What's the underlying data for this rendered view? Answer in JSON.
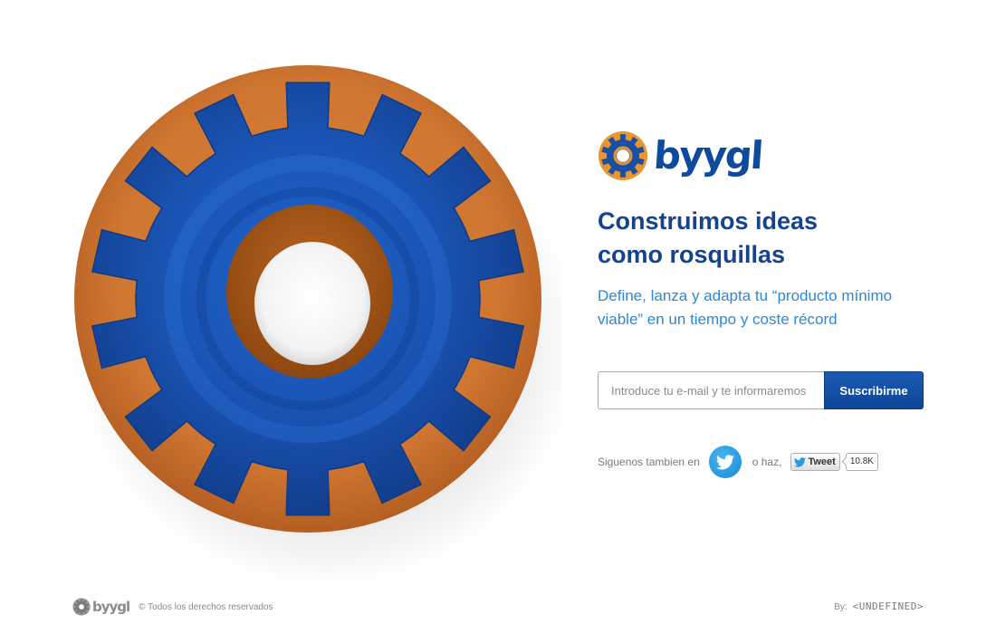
{
  "brand": {
    "name": "byygl",
    "logo_icon": "gear-donut-icon"
  },
  "hero": {
    "illustration": "gear-donut-illustration",
    "headline_line1": "Construimos ideas",
    "headline_line2": "como rosquillas",
    "subheadline": "Define, lanza y adapta tu “producto mínimo viable” en un tiempo y coste récord"
  },
  "signup": {
    "email_placeholder": "Introduce tu e-mail y te informaremos",
    "email_value": "",
    "submit_label": "Suscribirme"
  },
  "social": {
    "follow_text": "Siguenos tambien en",
    "follow_icon": "twitter-bird-icon",
    "or_text": "o haz,",
    "tweet_label": "Tweet",
    "tweet_count": "10.8K"
  },
  "footer": {
    "brand": "byygl",
    "copyright": "© Todos los derechos reservados",
    "credit_prefix": "By:",
    "credit_name": "<UNDEFINED>"
  },
  "colors": {
    "brand_blue": "#15438c",
    "accent_blue": "#2c88d9",
    "glaze_blue": "#1a55b5",
    "dough_orange": "#d07a32",
    "muted_text": "#8a8a8a"
  }
}
